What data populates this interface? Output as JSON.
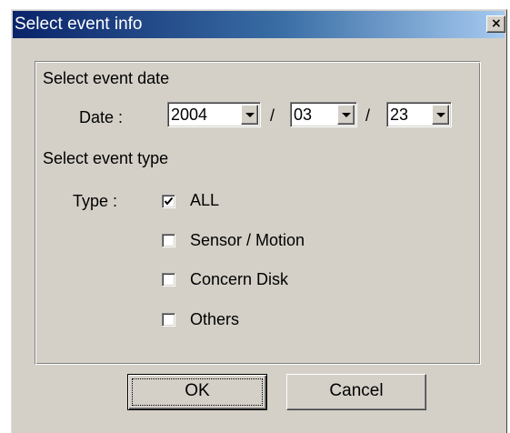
{
  "window": {
    "title": "Select event info",
    "close_glyph": "×",
    "close_icon": "close-icon"
  },
  "date_section": {
    "heading": "Select event date",
    "label": "Date :",
    "separator": "/",
    "year": "2004",
    "month": "03",
    "day": "23"
  },
  "type_section": {
    "heading": "Select event type",
    "label": "Type :",
    "options": [
      {
        "label": "ALL",
        "checked": true
      },
      {
        "label": "Sensor / Motion",
        "checked": false
      },
      {
        "label": "Concern Disk",
        "checked": false
      },
      {
        "label": "Others",
        "checked": false
      }
    ]
  },
  "buttons": {
    "ok": "OK",
    "cancel": "Cancel"
  }
}
